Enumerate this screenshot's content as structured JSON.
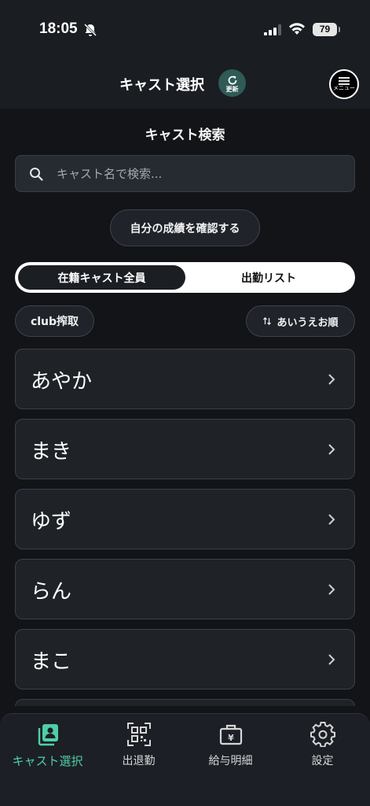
{
  "status_bar": {
    "time": "18:05",
    "battery": "79"
  },
  "header": {
    "title": "キャスト選択",
    "refresh_label": "更新",
    "menu_label": "メニュー"
  },
  "search": {
    "section_title": "キャスト検索",
    "placeholder": "キャスト名で検索...",
    "value": ""
  },
  "performance_button": "自分の成績を確認する",
  "tabs": [
    {
      "label": "在籍キャスト全員",
      "selected": true
    },
    {
      "label": "出勤リスト",
      "selected": false
    }
  ],
  "filters": {
    "club_label": "club搾取",
    "sort_label": "あいうえお順"
  },
  "casts": [
    "あやか",
    "まき",
    "ゆず",
    "らん",
    "まこ"
  ],
  "bottom_nav": [
    {
      "label": "キャスト選択",
      "icon": "cast-select-icon",
      "active": true
    },
    {
      "label": "出退勤",
      "icon": "qr-code-icon",
      "active": false
    },
    {
      "label": "給与明細",
      "icon": "salary-icon",
      "active": false
    },
    {
      "label": "設定",
      "icon": "gear-icon",
      "active": false
    }
  ],
  "colors": {
    "accent": "#4fcfa7",
    "background": "#121418",
    "card": "#1f2328",
    "refresh_button": "#2f5a56"
  }
}
